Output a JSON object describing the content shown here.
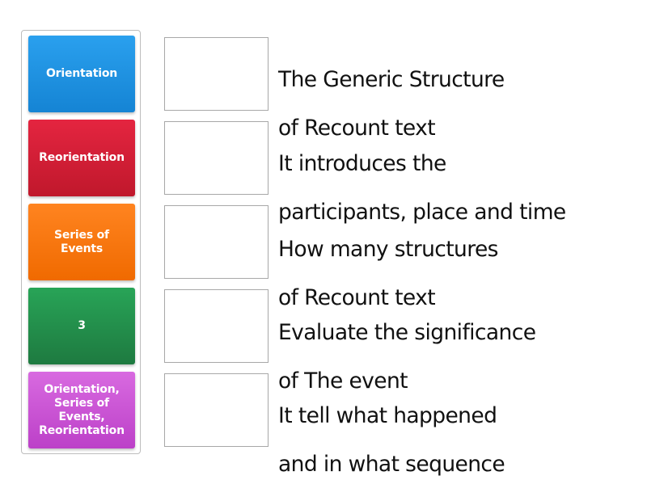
{
  "tiles": [
    {
      "label": "Orientation",
      "color": "#2196e6",
      "color_dark": "#1584d4"
    },
    {
      "label": "Reorientation",
      "color": "#e01e37",
      "color_dark": "#c0182c"
    },
    {
      "label": "Series of Events",
      "color": "#ff7a12",
      "color_dark": "#f06a00"
    },
    {
      "label": "3",
      "color": "#259b52",
      "color_dark": "#1e7e42"
    },
    {
      "label": "Orientation, Series of Events, Reorientation",
      "color": "#d05ed8",
      "color_dark": "#bc40c8"
    }
  ],
  "prompts": [
    {
      "line1": "The Generic Structure",
      "line2": "of Recount text"
    },
    {
      "line1": "It introduces the",
      "line2": "participants, place and time"
    },
    {
      "line1": "How many structures",
      "line2": "of Recount text"
    },
    {
      "line1": "Evaluate the significance",
      "line2": "of The event"
    },
    {
      "line1": "It tell what happened",
      "line2": "and in what sequence"
    }
  ]
}
